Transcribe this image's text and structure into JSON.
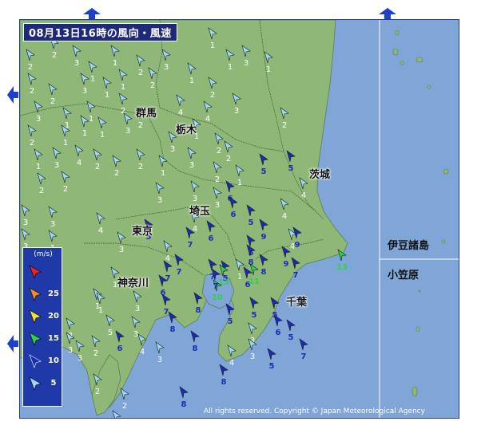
{
  "title": "08月13日16時の風向・風速",
  "copyright": "All rights reserved. Copyright © Japan Meteorological Agency",
  "legend": {
    "unit": "(m/s)",
    "items": [
      {
        "value": "",
        "color": "#e8262b"
      },
      {
        "value": "25",
        "color": "#f08c2a"
      },
      {
        "value": "20",
        "color": "#f3e23a"
      },
      {
        "value": "15",
        "color": "#2ed24c"
      },
      {
        "value": "10",
        "color": "#1c2bb5"
      },
      {
        "value": "5",
        "color": "#9fd8f5"
      }
    ]
  },
  "prefectures": [
    {
      "name": "群馬"
    },
    {
      "name": "栃木"
    },
    {
      "name": "茨城"
    },
    {
      "name": "埼玉"
    },
    {
      "name": "東京"
    },
    {
      "name": "神奈川"
    },
    {
      "name": "千葉"
    }
  ],
  "regions": [
    {
      "name": "伊豆諸島"
    },
    {
      "name": "小笠原"
    }
  ],
  "colors": {
    "sea": "#7fa6d6",
    "land": "#8fb878",
    "calm_arrow": "#9fd8f5",
    "blue_arrow": "#1c2bb5",
    "green_arrow": "#2ed24c",
    "frame": "#2a3a8c"
  },
  "stations": [
    {
      "s": "2",
      "c": "w"
    },
    {
      "s": "2",
      "c": "w"
    },
    {
      "s": "3",
      "c": "w"
    },
    {
      "s": "1",
      "c": "w"
    },
    {
      "s": "1",
      "c": "w"
    },
    {
      "s": "2",
      "c": "w"
    },
    {
      "s": "3",
      "c": "w"
    },
    {
      "s": "1",
      "c": "w"
    },
    {
      "s": "1",
      "c": "w"
    },
    {
      "s": "2",
      "c": "w"
    },
    {
      "s": "2",
      "c": "w"
    },
    {
      "s": "3",
      "c": "w"
    },
    {
      "s": "1",
      "c": "w"
    },
    {
      "s": "1",
      "c": "w"
    },
    {
      "s": "2",
      "c": "w"
    },
    {
      "s": "1",
      "c": "w"
    },
    {
      "s": "2",
      "c": "w"
    },
    {
      "s": "3",
      "c": "w"
    },
    {
      "s": "3",
      "c": "w"
    },
    {
      "s": "1",
      "c": "w"
    },
    {
      "s": "1",
      "c": "w"
    },
    {
      "s": "2",
      "c": "w"
    },
    {
      "s": "2",
      "c": "w"
    },
    {
      "s": "4",
      "c": "w"
    },
    {
      "s": "4",
      "c": "w"
    },
    {
      "s": "3",
      "c": "w"
    },
    {
      "s": "1",
      "c": "w"
    },
    {
      "s": "2",
      "c": "w"
    },
    {
      "s": "1",
      "c": "w"
    },
    {
      "s": "1",
      "c": "w"
    },
    {
      "s": "1",
      "c": "w"
    },
    {
      "s": "3",
      "c": "w"
    },
    {
      "s": "3",
      "c": "w"
    },
    {
      "s": "1",
      "c": "w"
    },
    {
      "s": "2",
      "c": "w"
    },
    {
      "s": "2",
      "c": "w"
    },
    {
      "s": "1",
      "c": "w"
    },
    {
      "s": "3",
      "c": "w"
    },
    {
      "s": "4",
      "c": "w"
    },
    {
      "s": "2",
      "c": "w"
    },
    {
      "s": "2",
      "c": "w"
    },
    {
      "s": "2",
      "c": "w"
    },
    {
      "s": "1",
      "c": "w"
    },
    {
      "s": "3",
      "c": "w"
    },
    {
      "s": "2",
      "c": "w"
    },
    {
      "s": "2",
      "c": "w"
    },
    {
      "s": "2",
      "c": "w"
    },
    {
      "s": "5",
      "c": "b"
    },
    {
      "s": "5",
      "c": "b"
    },
    {
      "s": "3",
      "c": "w"
    },
    {
      "s": "3",
      "c": "w"
    },
    {
      "s": "3",
      "c": "w"
    },
    {
      "s": "2",
      "c": "w"
    },
    {
      "s": "1",
      "c": "w"
    },
    {
      "s": "3",
      "c": "w"
    },
    {
      "s": "3",
      "c": "w"
    },
    {
      "s": "4",
      "c": "w"
    },
    {
      "s": "6",
      "c": "b"
    },
    {
      "s": "6",
      "c": "b"
    },
    {
      "s": "4",
      "c": "w"
    },
    {
      "s": "5",
      "c": "b"
    },
    {
      "s": "4",
      "c": "w"
    },
    {
      "s": "4",
      "c": "w"
    },
    {
      "s": "3",
      "c": "w"
    },
    {
      "s": "1",
      "c": "w"
    },
    {
      "s": "3",
      "c": "w"
    },
    {
      "s": "5",
      "c": "b"
    },
    {
      "s": "4",
      "c": "w"
    },
    {
      "s": "7",
      "c": "b"
    },
    {
      "s": "6",
      "c": "b"
    },
    {
      "s": "5",
      "c": "b"
    },
    {
      "s": "9",
      "c": "b"
    },
    {
      "s": "4",
      "c": "w"
    },
    {
      "s": "1",
      "c": "w"
    },
    {
      "s": "7",
      "c": "b"
    },
    {
      "s": "7",
      "c": "b"
    },
    {
      "s": "5",
      "c": "b"
    },
    {
      "s": "8",
      "c": "b"
    },
    {
      "s": "9",
      "c": "b"
    },
    {
      "s": "7",
      "c": "b"
    },
    {
      "s": "13",
      "c": "g"
    },
    {
      "s": "1",
      "c": "w"
    },
    {
      "s": "5",
      "c": "w"
    },
    {
      "s": "6",
      "c": "b"
    },
    {
      "s": "7",
      "c": "b"
    },
    {
      "s": "13",
      "c": "g"
    },
    {
      "s": "11",
      "c": "g"
    },
    {
      "s": "6",
      "c": "b"
    },
    {
      "s": "8",
      "c": "b"
    },
    {
      "s": "10",
      "c": "g"
    },
    {
      "s": "1",
      "c": "w"
    },
    {
      "s": "7",
      "c": "b"
    },
    {
      "s": "8",
      "c": "b"
    },
    {
      "s": "5",
      "c": "b"
    },
    {
      "s": "5",
      "c": "b"
    },
    {
      "s": "5",
      "c": "b"
    },
    {
      "s": "3",
      "c": "w"
    },
    {
      "s": "3",
      "c": "w"
    },
    {
      "s": "5",
      "c": "b"
    },
    {
      "s": "8",
      "c": "b"
    },
    {
      "s": "8",
      "c": "b"
    },
    {
      "s": "4",
      "c": "w"
    },
    {
      "s": "3",
      "c": "w"
    },
    {
      "s": "6",
      "c": "b"
    },
    {
      "s": "3",
      "c": "w"
    },
    {
      "s": "5",
      "c": "b"
    },
    {
      "s": "3",
      "c": "w"
    },
    {
      "s": "8",
      "c": "b"
    },
    {
      "s": "2",
      "c": "w"
    },
    {
      "s": "3",
      "c": "w"
    },
    {
      "s": "8",
      "c": "b"
    },
    {
      "s": "8",
      "c": "b"
    },
    {
      "s": "2",
      "c": "w"
    },
    {
      "s": "7",
      "c": "b"
    },
    {
      "s": "6",
      "c": "b"
    },
    {
      "s": "9",
      "c": "b"
    },
    {
      "s": "5",
      "c": "b"
    },
    {
      "s": "7",
      "c": "b"
    },
    {
      "s": "2",
      "c": "w"
    },
    {
      "s": "3",
      "c": "w"
    },
    {
      "s": "4",
      "c": "w"
    },
    {
      "s": "2",
      "c": "w"
    },
    {
      "s": "3",
      "c": "w"
    },
    {
      "s": "1",
      "c": "w"
    }
  ]
}
